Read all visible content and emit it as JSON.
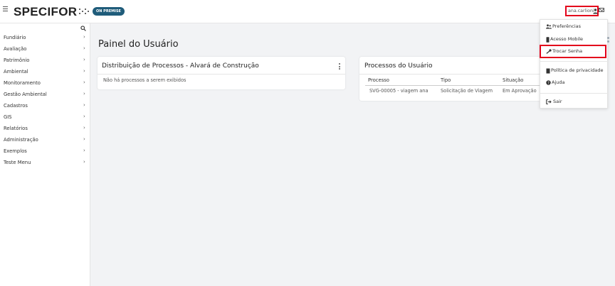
{
  "header": {
    "logo_text": "SPECIFOR",
    "badge": "ON PREMISE",
    "user_name": "ana.carlioni",
    "icons": [
      "menu-icon",
      "user-icon",
      "envelope-icon"
    ]
  },
  "sidebar": {
    "search_icon": "search-icon",
    "items": [
      {
        "label": "Fundiário"
      },
      {
        "label": "Avaliação"
      },
      {
        "label": "Patrimônio"
      },
      {
        "label": "Ambiental"
      },
      {
        "label": "Monitoramento"
      },
      {
        "label": "Gestão Ambiental"
      },
      {
        "label": "Cadastros"
      },
      {
        "label": "GIS"
      },
      {
        "label": "Relatórios"
      },
      {
        "label": "Administração"
      },
      {
        "label": "Exemplos"
      },
      {
        "label": "Teste Menu"
      }
    ],
    "chevron": "›"
  },
  "main": {
    "title": "Painel do Usuário",
    "card1": {
      "title": "Distribuição de Processos - Alvará de Construção",
      "empty": "Não há processos a serem exibidos"
    },
    "card2": {
      "title": "Processos do Usuário",
      "columns": [
        "Processo",
        "Tipo",
        "Situação"
      ],
      "rows": [
        [
          "SVG-00005 - viagem ana",
          "Solicitação de Viagem",
          "Em Aprovação"
        ]
      ]
    }
  },
  "dropdown": {
    "items": [
      {
        "label": "Preferências",
        "icon": "users-icon"
      },
      {
        "label": "Acesso Mobile",
        "icon": "mobile-icon"
      },
      {
        "label": "Trocar Senha",
        "icon": "key-icon"
      },
      {
        "label": "Política de privacidade",
        "icon": "document-icon"
      },
      {
        "label": "Ajuda",
        "icon": "question-icon"
      },
      {
        "label": "Sair",
        "icon": "logout-icon"
      }
    ]
  },
  "colors": {
    "accent": "#1f5c7a",
    "highlight": "#e3001b"
  }
}
